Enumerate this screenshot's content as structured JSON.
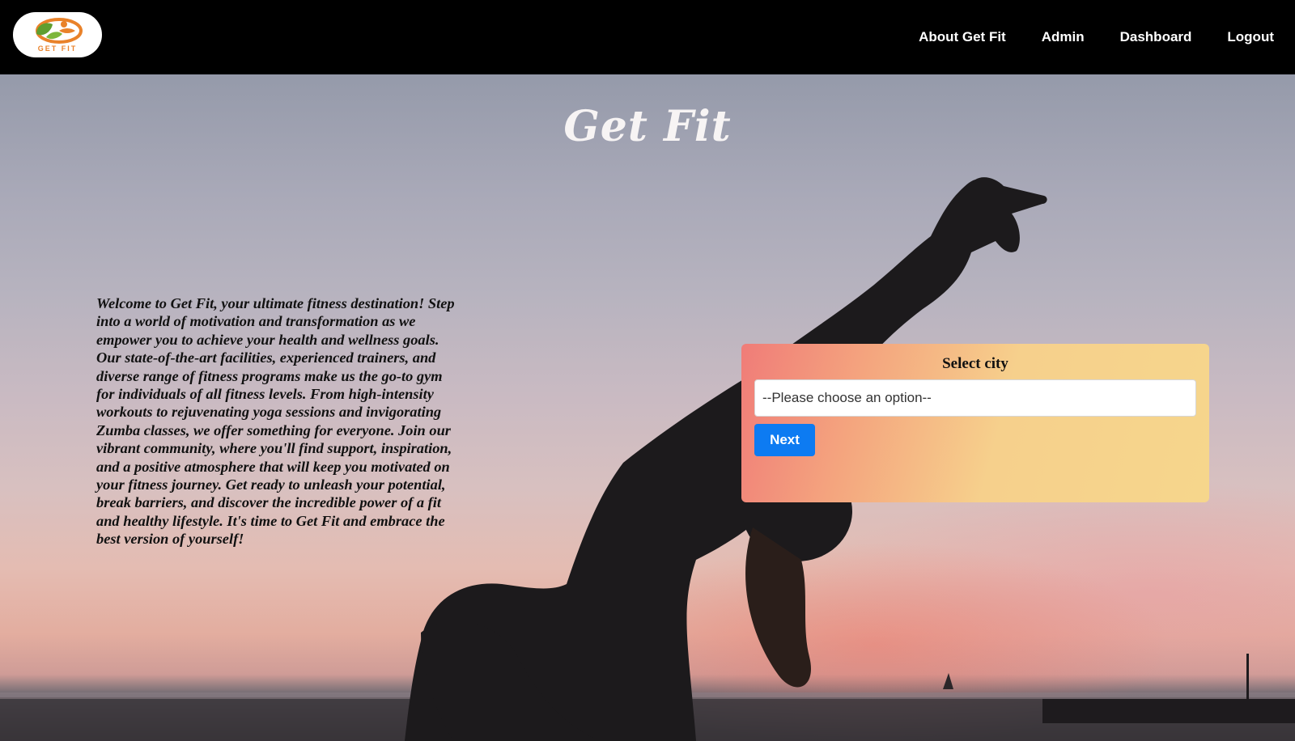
{
  "brand": {
    "logo_text": "GET FIT"
  },
  "nav": {
    "items": [
      {
        "label": "About Get Fit"
      },
      {
        "label": "Admin"
      },
      {
        "label": "Dashboard"
      },
      {
        "label": "Logout"
      }
    ]
  },
  "hero": {
    "title": "Get Fit",
    "intro": "Welcome to Get Fit, your ultimate fitness destination! Step into a world of motivation and transformation as we empower you to achieve your health and wellness goals. Our state-of-the-art facilities, experienced trainers, and diverse range of fitness programs make us the go-to gym for individuals of all fitness levels. From high-intensity workouts to rejuvenating yoga sessions and invigorating Zumba classes, we offer something for everyone. Join our vibrant community, where you'll find support, inspiration, and a positive atmosphere that will keep you motivated on your fitness journey. Get ready to unleash your potential, break barriers, and discover the incredible power of a fit and healthy lifestyle. It's time to Get Fit and embrace the best version of yourself!"
  },
  "city_form": {
    "label": "Select city",
    "select_value": "--Please choose an option--",
    "next_label": "Next"
  },
  "colors": {
    "navbar": "#000000",
    "next_button": "#0d7bf2",
    "card_gradient_start": "#f07c78",
    "card_gradient_end": "#f6d68c"
  },
  "icons": {
    "logo": "get-fit-logo-icon"
  }
}
